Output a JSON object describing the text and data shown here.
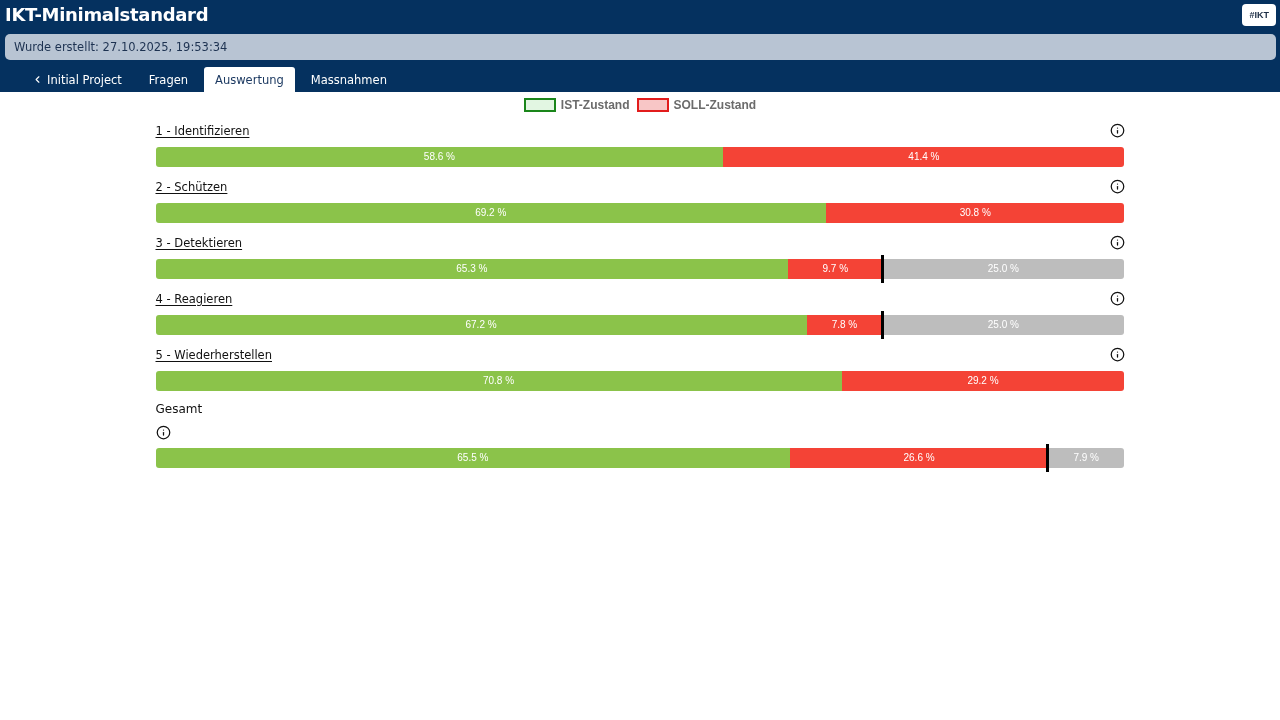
{
  "header": {
    "title": "IKT-Minimalstandard",
    "badge": "#IKT"
  },
  "created_bar": {
    "text": "Wurde erstellt: 27.10.2025, 19:53:34"
  },
  "tabs": [
    {
      "label": "Initial Project",
      "kind": "back",
      "selected": false
    },
    {
      "label": "Fragen",
      "kind": "tab",
      "selected": false
    },
    {
      "label": "Auswertung",
      "kind": "tab",
      "selected": true
    },
    {
      "label": "Massnahmen",
      "kind": "tab",
      "selected": false
    }
  ],
  "legend": [
    {
      "label": "IST-Zustand",
      "kind": "ist"
    },
    {
      "label": "SOLL-Zustand",
      "kind": "soll"
    }
  ],
  "sections": [
    {
      "title": "1 - Identifizieren",
      "kind": "function",
      "segments": [
        {
          "kind": "ist",
          "label": "58.6 %"
        },
        {
          "kind": "soll",
          "label": "41.4 %"
        }
      ]
    },
    {
      "title": "2 - Schützen",
      "kind": "function",
      "segments": [
        {
          "kind": "ist",
          "label": "69.2 %"
        },
        {
          "kind": "soll",
          "label": "30.8 %"
        }
      ]
    },
    {
      "title": "3 - Detektieren",
      "kind": "function",
      "segments": [
        {
          "kind": "ist",
          "label": "65.3 %"
        },
        {
          "kind": "soll",
          "label": "9.7 %"
        },
        {
          "kind": "rest",
          "label": "25.0 %"
        }
      ]
    },
    {
      "title": "4 - Reagieren",
      "kind": "function",
      "segments": [
        {
          "kind": "ist",
          "label": "67.2 %"
        },
        {
          "kind": "soll",
          "label": "7.8 %"
        },
        {
          "kind": "rest",
          "label": "25.0 %"
        }
      ]
    },
    {
      "title": "5 - Wiederherstellen",
      "kind": "function",
      "segments": [
        {
          "kind": "ist",
          "label": "70.8 %"
        },
        {
          "kind": "soll",
          "label": "29.2 %"
        }
      ]
    },
    {
      "title": "Gesamt",
      "kind": "total",
      "segments": [
        {
          "kind": "ist",
          "label": "65.5 %"
        },
        {
          "kind": "soll",
          "label": "26.6 %"
        },
        {
          "kind": "rest",
          "label": "7.9 %"
        }
      ]
    }
  ]
}
